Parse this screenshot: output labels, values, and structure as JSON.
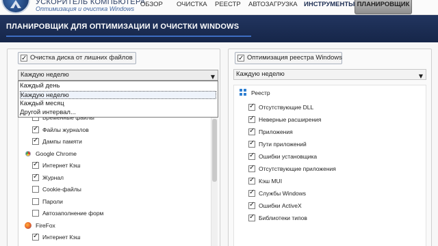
{
  "app": {
    "title": "УСКОРИТЕЛЬ КОМПЬЮТЕРА",
    "subtitle": "Оптимизация и очистка Windows"
  },
  "tabs": {
    "overview": "ОБЗОР",
    "cleanup": "ОЧИСТКА",
    "registry": "РЕЕСТР",
    "autoload": "АВТОЗАГРУЗКА",
    "tools": "ИНСТРУМЕНТЫ",
    "scheduler": "ПЛАНИРОВЩИК"
  },
  "page": {
    "title": "ПЛАНИРОВЩИК ДЛЯ ОПТИМИЗАЦИИ И ОЧИСТКИ WINDOWS"
  },
  "left_panel": {
    "header": "Очистка диска от лишних файлов",
    "header_checked": true,
    "select_value": "Каждую неделю",
    "dropdown_options": [
      "Каждый день",
      "Каждую неделю",
      "Каждый месяц",
      "Другой интервал..."
    ],
    "dropdown_selected_index": 1,
    "items": [
      {
        "type": "item",
        "label": "Временные файлы",
        "checked": true
      },
      {
        "type": "item",
        "label": "Файлы журналов",
        "checked": true
      },
      {
        "type": "item",
        "label": "Дампы памяти",
        "checked": true
      },
      {
        "type": "category",
        "label": "Google Chrome",
        "icon": "chrome-icon"
      },
      {
        "type": "item",
        "label": "Интернет Кэш",
        "checked": true
      },
      {
        "type": "item",
        "label": "Журнал",
        "checked": true
      },
      {
        "type": "item",
        "label": "Cookie-файлы",
        "checked": false
      },
      {
        "type": "item",
        "label": "Пароли",
        "checked": false
      },
      {
        "type": "item",
        "label": "Автозаполнение форм",
        "checked": false
      },
      {
        "type": "category",
        "label": "FireFox",
        "icon": "firefox-icon"
      },
      {
        "type": "item",
        "label": "Интернет Кэш",
        "checked": true
      }
    ]
  },
  "right_panel": {
    "header": "Оптимизация реестра Windows",
    "header_checked": true,
    "select_value": "Каждую неделю",
    "category": "Реестр",
    "items": [
      {
        "label": "Отсутствующие DLL",
        "checked": true
      },
      {
        "label": "Неверные расширения",
        "checked": true
      },
      {
        "label": "Приложения",
        "checked": true
      },
      {
        "label": "Пути приложений",
        "checked": true
      },
      {
        "label": "Ошибки установщика",
        "checked": true
      },
      {
        "label": "Отсутствующие приложения",
        "checked": true
      },
      {
        "label": "Кэш MUI",
        "checked": true
      },
      {
        "label": "Службы Windows",
        "checked": true
      },
      {
        "label": "Ошибки ActiveX",
        "checked": true
      },
      {
        "label": "Библиотеки типов",
        "checked": true
      }
    ]
  }
}
